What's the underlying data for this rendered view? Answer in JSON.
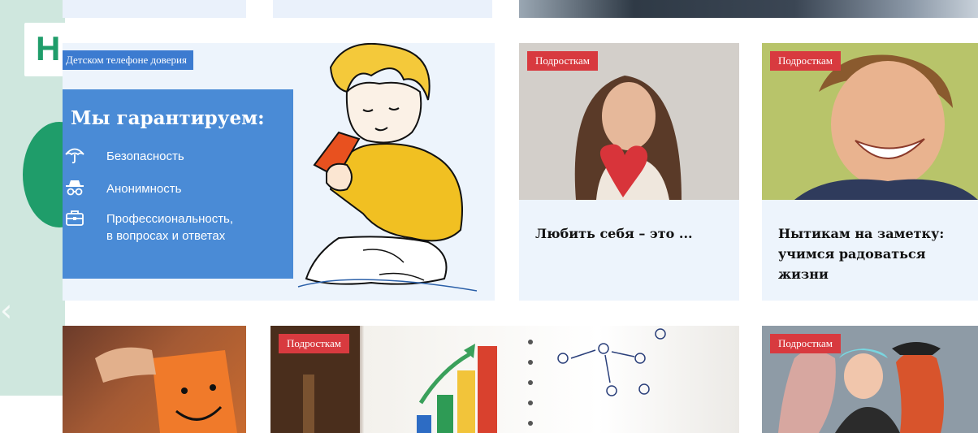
{
  "underlay": {
    "logo_letter": "Н",
    "arrow": "‹"
  },
  "hero": {
    "ribbon": "Детском телефоне доверия",
    "heading": "Мы гарантируем:",
    "features": [
      {
        "icon": "umbrella-icon",
        "lines": [
          "Безопасность"
        ]
      },
      {
        "icon": "incognito-icon",
        "lines": [
          "Анонимность"
        ]
      },
      {
        "icon": "briefcase-icon",
        "lines": [
          "Профессиональность,",
          "в вопросах и ответах"
        ]
      }
    ]
  },
  "cards": [
    {
      "category": "Подросткам",
      "title": "Любить себя – это ..."
    },
    {
      "category": "Подросткам",
      "title": "Нытикам на заметку: учимся радоваться жизни"
    }
  ],
  "bottom_cards": [
    {
      "category": ""
    },
    {
      "category": "Подросткам"
    },
    {
      "category": "Подросткам"
    }
  ],
  "colors": {
    "accent_blue": "#4a8bd6",
    "pill_red": "#d83a3f",
    "card_bg": "#edf4fc",
    "brand_green": "#1f9d6a"
  }
}
